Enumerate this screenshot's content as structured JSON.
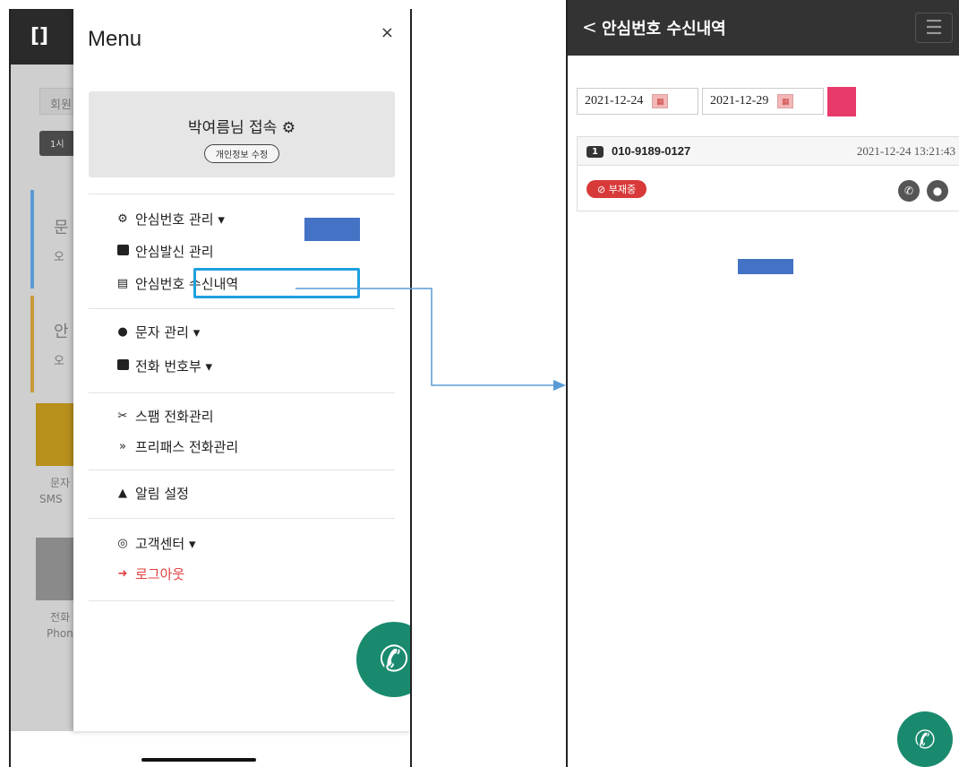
{
  "left": {
    "background": {
      "logo": "[]",
      "tabs": [
        "회원",
        "1시"
      ],
      "card1": {
        "title": "문",
        "sub": "오"
      },
      "card2": {
        "title": "안",
        "sub": "오"
      },
      "tile1": [
        "문자",
        "SMS"
      ],
      "tile2": [
        "전화",
        "Phone"
      ]
    },
    "menu": {
      "title": "Menu",
      "close": "×",
      "user_name": "박여름님 접속 ⚙",
      "edit_profile": "개인정보 수정",
      "groups": [
        [
          {
            "label": "안심번호 관리 ▾",
            "icon": "gear-icon"
          },
          {
            "label": "안심발신 관리",
            "icon": "phone-square-icon"
          },
          {
            "label": "안심번호 수신내역",
            "icon": "list-icon"
          }
        ],
        [
          {
            "label": "문자 관리 ▾",
            "icon": "chat-icon"
          },
          {
            "label": "전화 번호부 ▾",
            "icon": "contact-icon"
          }
        ],
        [
          {
            "label": "스팸 전화관리",
            "icon": "spam-icon"
          },
          {
            "label": "프리패스 전화관리",
            "icon": "double-arrow-icon"
          }
        ],
        [
          {
            "label": "알림 설정",
            "icon": "bell-icon"
          }
        ],
        [
          {
            "label": "고객센터 ▾",
            "icon": "headset-icon"
          },
          {
            "label": "로그아웃",
            "icon": "logout-icon"
          }
        ]
      ]
    }
  },
  "right": {
    "header": {
      "back": "<",
      "title": "안심번호 수신내역",
      "menu": "☰"
    },
    "filter": {
      "start_date": "2021-12-24",
      "end_date": "2021-12-29"
    },
    "records": [
      {
        "index": "1",
        "phone": "010-9189-0127",
        "time": "2021-12-24 13:21:43",
        "status": "⊘ 부재중"
      }
    ]
  },
  "colors": {
    "highlight": "#1fa0e0",
    "annotation": "#4472c4",
    "fab": "#1a8a6e",
    "search_button": "#e83a6a",
    "status_missed": "#d83a3a"
  }
}
